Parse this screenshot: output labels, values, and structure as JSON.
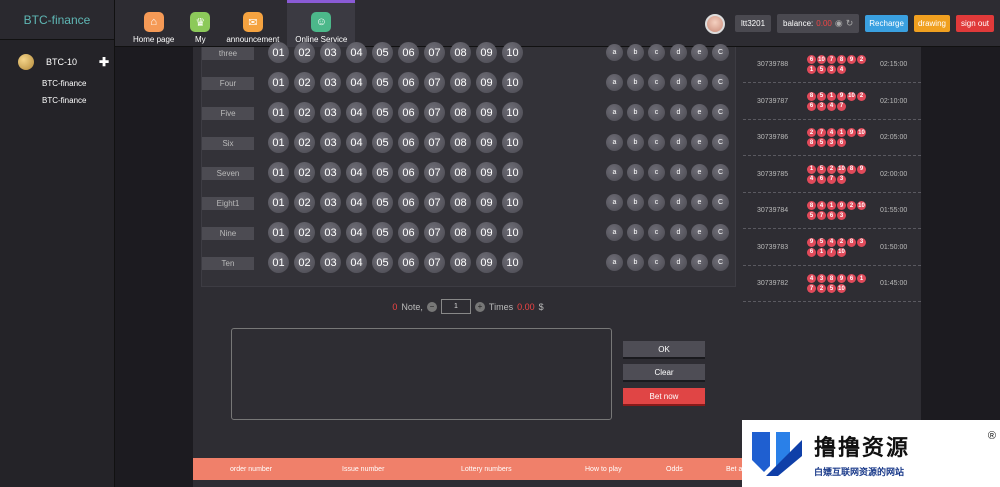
{
  "brand": "BTC-finance",
  "sidebar": {
    "game": "BTC-10",
    "items": [
      "BTC-finance",
      "BTC-finance"
    ]
  },
  "nav": [
    {
      "label": "Home page",
      "icon": "home-icon"
    },
    {
      "label": "My",
      "icon": "crown-icon"
    },
    {
      "label": "announcement",
      "icon": "mail-icon"
    },
    {
      "label": "Online Service",
      "icon": "service-icon"
    }
  ],
  "user": {
    "name": "ltt3201",
    "balance_label": "balance:",
    "balance_value": "0.00",
    "recharge": "Recharge",
    "drawing": "drawing",
    "signout": "sign out"
  },
  "board": {
    "rows": [
      "three",
      "Four",
      "Five",
      "Six",
      "Seven",
      "Eight1",
      "Nine",
      "Ten"
    ],
    "numbers": [
      "01",
      "02",
      "03",
      "04",
      "05",
      "06",
      "07",
      "08",
      "09",
      "10"
    ],
    "options": [
      "a",
      "b",
      "c",
      "d",
      "e",
      "C"
    ]
  },
  "stake": {
    "notes": "0",
    "notes_label": "Note,",
    "times_value": "1",
    "times_label": "Times",
    "amount": "0.00",
    "currency": "$"
  },
  "actions": {
    "ok": "OK",
    "clear": "Clear",
    "bet": "Bet now"
  },
  "table_head": [
    "order number",
    "Issue number",
    "Lottery numbers",
    "How to play",
    "Odds",
    "Bet a"
  ],
  "results": [
    {
      "issue": "30739788",
      "balls": [
        "6",
        "10",
        "7",
        "8",
        "9",
        "2",
        "1",
        "5",
        "3",
        "4"
      ],
      "time": "02:15:00"
    },
    {
      "issue": "30739787",
      "balls": [
        "8",
        "5",
        "1",
        "9",
        "10",
        "2",
        "6",
        "3",
        "4",
        "7"
      ],
      "time": "02:10:00"
    },
    {
      "issue": "30739786",
      "balls": [
        "2",
        "7",
        "4",
        "1",
        "9",
        "10",
        "8",
        "5",
        "3",
        "6"
      ],
      "time": "02:05:00"
    },
    {
      "issue": "30739785",
      "balls": [
        "1",
        "5",
        "2",
        "10",
        "8",
        "9",
        "4",
        "6",
        "7",
        "3"
      ],
      "time": "02:00:00"
    },
    {
      "issue": "30739784",
      "balls": [
        "8",
        "4",
        "1",
        "9",
        "2",
        "10",
        "5",
        "7",
        "6",
        "3"
      ],
      "time": "01:55:00"
    },
    {
      "issue": "30739783",
      "balls": [
        "9",
        "5",
        "4",
        "2",
        "8",
        "3",
        "6",
        "1",
        "7",
        "10"
      ],
      "time": "01:50:00"
    },
    {
      "issue": "30739782",
      "balls": [
        "4",
        "3",
        "8",
        "9",
        "6",
        "1",
        "7",
        "2",
        "5",
        "10"
      ],
      "time": "01:45:00"
    }
  ],
  "watermark": {
    "title": "撸撸资源",
    "subtitle": "白嫖互联网资源的网站",
    "reg": "®"
  }
}
